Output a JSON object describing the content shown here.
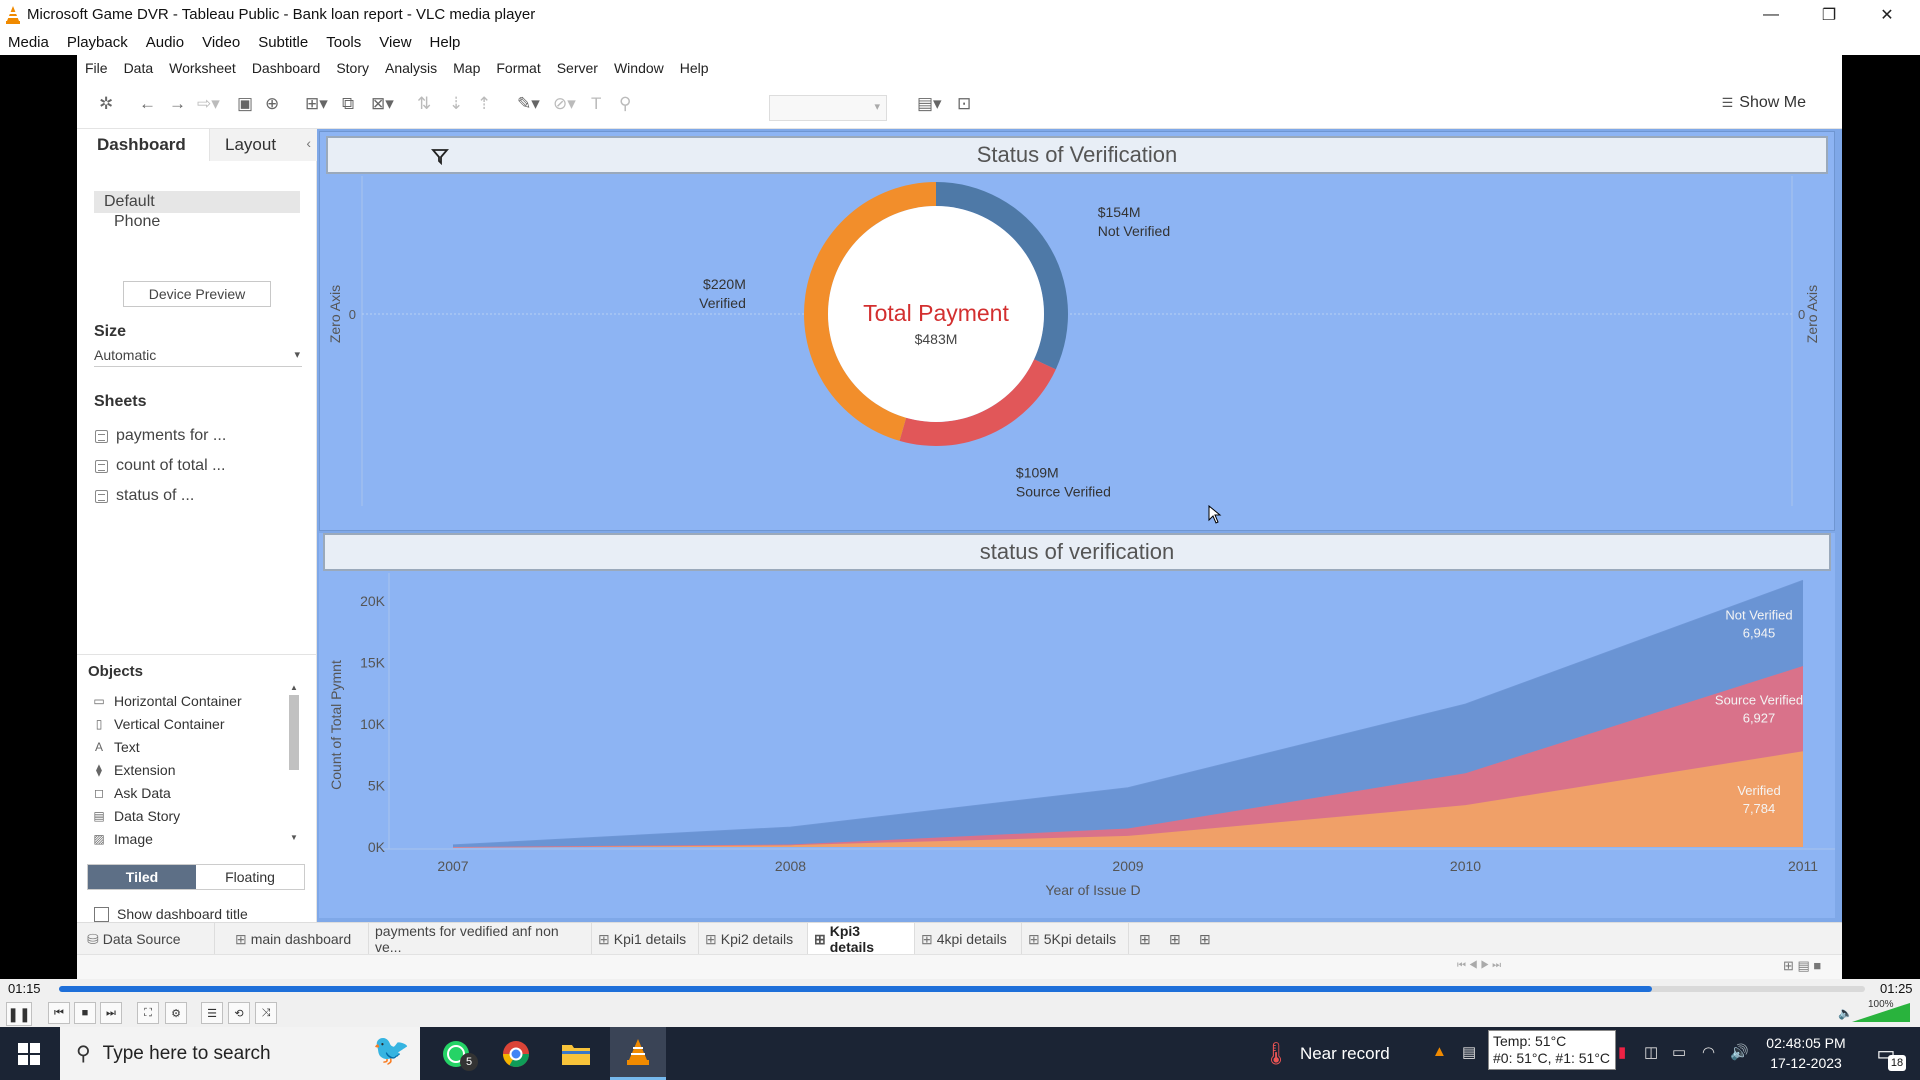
{
  "window": {
    "title": "Microsoft Game DVR - Tableau Public - Bank loan report - VLC media player",
    "controls": [
      "—",
      "❐",
      "✕"
    ]
  },
  "vlc_menu": [
    "Media",
    "Playback",
    "Audio",
    "Video",
    "Subtitle",
    "Tools",
    "View",
    "Help"
  ],
  "tableau_menu": [
    "File",
    "Data",
    "Worksheet",
    "Dashboard",
    "Story",
    "Analysis",
    "Map",
    "Format",
    "Server",
    "Window",
    "Help"
  ],
  "toolbar": {
    "show_me": "Show Me"
  },
  "left_panel": {
    "tab_dashboard": "Dashboard",
    "tab_layout": "Layout",
    "devices": [
      "Default",
      "Phone"
    ],
    "device_preview": "Device Preview",
    "size_title": "Size",
    "size_value": "Automatic",
    "sheets_title": "Sheets",
    "sheets": [
      "payments for ...",
      "count of total ...",
      "status of ..."
    ],
    "objects_title": "Objects",
    "objects": [
      "Horizontal Container",
      "Vertical Container",
      "Text",
      "Extension",
      "Ask Data",
      "Data Story",
      "Image"
    ],
    "tiled": "Tiled",
    "floating": "Floating",
    "show_dashboard_title": "Show dashboard title"
  },
  "dashboard": {
    "top_title": "Status of Verification",
    "bottom_title": "status of verification"
  },
  "chart_data": [
    {
      "type": "pie",
      "title": "Status of Verification",
      "center_title": "Total Payment",
      "center_value": "$483M",
      "axis_label": "Zero Axis",
      "axis_tick": "0",
      "slices": [
        {
          "name": "Not Verified",
          "label": "$154M",
          "value": 154,
          "color": "#4e79a7"
        },
        {
          "name": "Source Verified",
          "label": "$109M",
          "value": 109,
          "color": "#e15759"
        },
        {
          "name": "Verified",
          "label": "$220M",
          "value": 220,
          "color": "#f28e2b"
        }
      ]
    },
    {
      "type": "area",
      "title": "status of verification",
      "xlabel": "Year of Issue D",
      "ylabel": "Count of Total Pymnt",
      "x": [
        2007,
        2008,
        2009,
        2010,
        2011
      ],
      "ylim": [
        0,
        20000
      ],
      "yticks": [
        "0K",
        "5K",
        "10K",
        "15K",
        "20K"
      ],
      "xticks": [
        "2007",
        "2008",
        "2009",
        "2010",
        "2011"
      ],
      "series": [
        {
          "name": "Verified",
          "values": [
            0,
            150,
            900,
            3400,
            7784
          ],
          "color": "#f0a068",
          "end_label": "Verified",
          "end_value": "7,784"
        },
        {
          "name": "Source Verified",
          "values": [
            0,
            50,
            600,
            2600,
            6927
          ],
          "color": "#d9728a",
          "end_label": "Source Verified",
          "end_value": "6,927"
        },
        {
          "name": "Not Verified",
          "values": [
            150,
            1400,
            3300,
            5600,
            6945
          ],
          "color": "#6a94d4",
          "end_label": "Not Verified",
          "end_value": "6,945"
        }
      ]
    }
  ],
  "sheet_tabs": [
    "Data Source",
    "main dashboard",
    "payments for vedified anf non ve...",
    "Kpi1 details",
    "Kpi2 details",
    "Kpi3 details",
    "4kpi details",
    "5Kpi details"
  ],
  "active_tab": "Kpi3 details",
  "vlc": {
    "elapsed": "01:15",
    "total": "01:25",
    "progress": 0.882,
    "volume": "100%"
  },
  "taskbar": {
    "search_placeholder": "Type here to search",
    "weather": "Near record",
    "whatsapp_badge": "5",
    "time": "02:48:05 PM",
    "date": "17-12-2023",
    "notifications": "18",
    "temp_tooltip_line1": "Temp: 51°C",
    "temp_tooltip_line2": "#0: 51°C, #1: 51°C"
  }
}
